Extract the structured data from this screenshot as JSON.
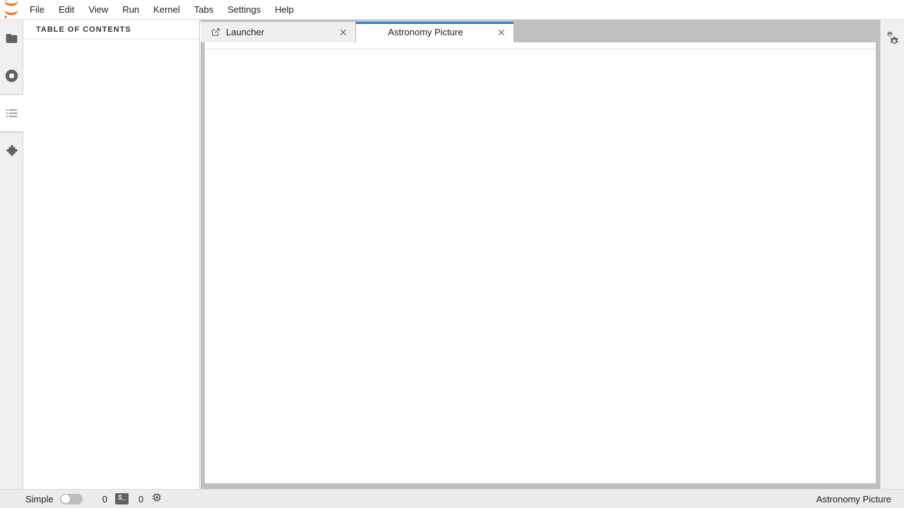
{
  "app": {
    "name": "JupyterLab",
    "logo_icon": "jupyter-logo-icon",
    "accent_color": "#2e7fd4",
    "logo_color": "#f37726"
  },
  "menubar": {
    "items": [
      {
        "label": "File",
        "name": "menu-file"
      },
      {
        "label": "Edit",
        "name": "menu-edit"
      },
      {
        "label": "View",
        "name": "menu-view"
      },
      {
        "label": "Run",
        "name": "menu-run"
      },
      {
        "label": "Kernel",
        "name": "menu-kernel"
      },
      {
        "label": "Tabs",
        "name": "menu-tabs"
      },
      {
        "label": "Settings",
        "name": "menu-settings"
      },
      {
        "label": "Help",
        "name": "menu-help"
      }
    ]
  },
  "left_sidebar": {
    "items": [
      {
        "icon": "folder-icon",
        "name": "sidebar-item-file-browser",
        "active": false
      },
      {
        "icon": "running-terminals-kernels-icon",
        "name": "sidebar-item-running",
        "active": false
      },
      {
        "icon": "table-of-contents-icon",
        "name": "sidebar-item-table-of-contents",
        "active": true
      },
      {
        "icon": "extension-puzzle-icon",
        "name": "sidebar-item-extension-manager",
        "active": false
      }
    ]
  },
  "toc_panel": {
    "title": "TABLE OF CONTENTS",
    "content": ""
  },
  "dock": {
    "tabs": [
      {
        "label": "Launcher",
        "icon": "launcher-icon",
        "close_icon": "close-icon",
        "active": false,
        "name": "tab-launcher"
      },
      {
        "label": "Astronomy Picture",
        "icon": "",
        "close_icon": "close-icon",
        "active": true,
        "name": "tab-astronomy-picture"
      }
    ],
    "document": {
      "title": "Astronomy Picture",
      "body_text": ""
    }
  },
  "right_sidebar": {
    "items": [
      {
        "icon": "property-inspector-gears-icon",
        "name": "sidebar-item-property-inspector"
      }
    ]
  },
  "statusbar": {
    "simple_label": "Simple",
    "simple_enabled": false,
    "terminal_count": "0",
    "terminal_icon": "terminal-icon",
    "terminal_glyph": "$_",
    "kernel_count": "0",
    "kernel_icon": "kernel-cpu-icon",
    "active_document": "Astronomy Picture"
  }
}
